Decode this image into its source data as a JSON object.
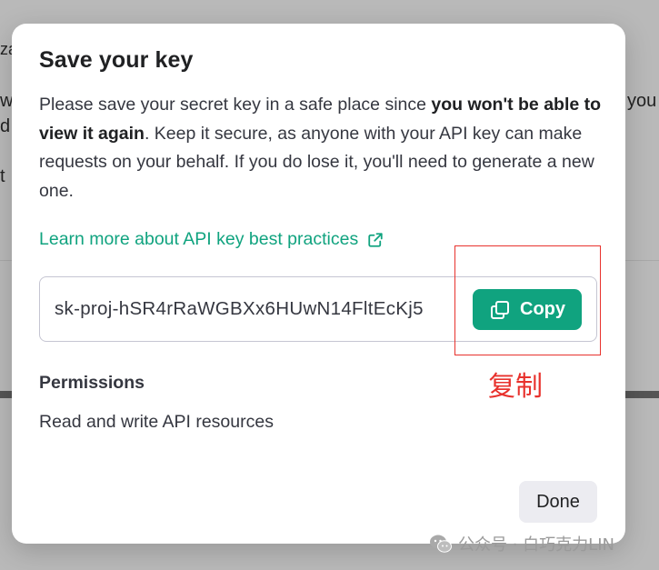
{
  "background": {
    "fragments": [
      "za",
      "w",
      "d",
      "t",
      "you"
    ]
  },
  "modal": {
    "title": "Save your key",
    "description_part1": "Please save your secret key in a safe place since ",
    "description_bold": "you won't be able to view it again",
    "description_part2": ". Keep it secure, as anyone with your API key can make requests on your behalf. If you do lose it, you'll need to generate a new one.",
    "learn_more_link": "Learn more about API key best practices",
    "link_icon": "external-link-icon",
    "api_key_value": "sk-proj-hSR4rRaWGBXx6HUwN14FltEcKj5",
    "copy_button_label": "Copy",
    "copy_icon": "copy-icon",
    "permissions_heading": "Permissions",
    "permissions_value": "Read and write API resources",
    "done_button_label": "Done"
  },
  "annotation": {
    "label": "复制",
    "color": "#e8322d"
  },
  "watermark": {
    "text": "公众号 · 白巧克力LIN",
    "icon": "wechat-icon"
  },
  "colors": {
    "accent": "#10a37f",
    "text_primary": "#202123",
    "text_secondary": "#353740",
    "done_bg": "#ececf1"
  }
}
